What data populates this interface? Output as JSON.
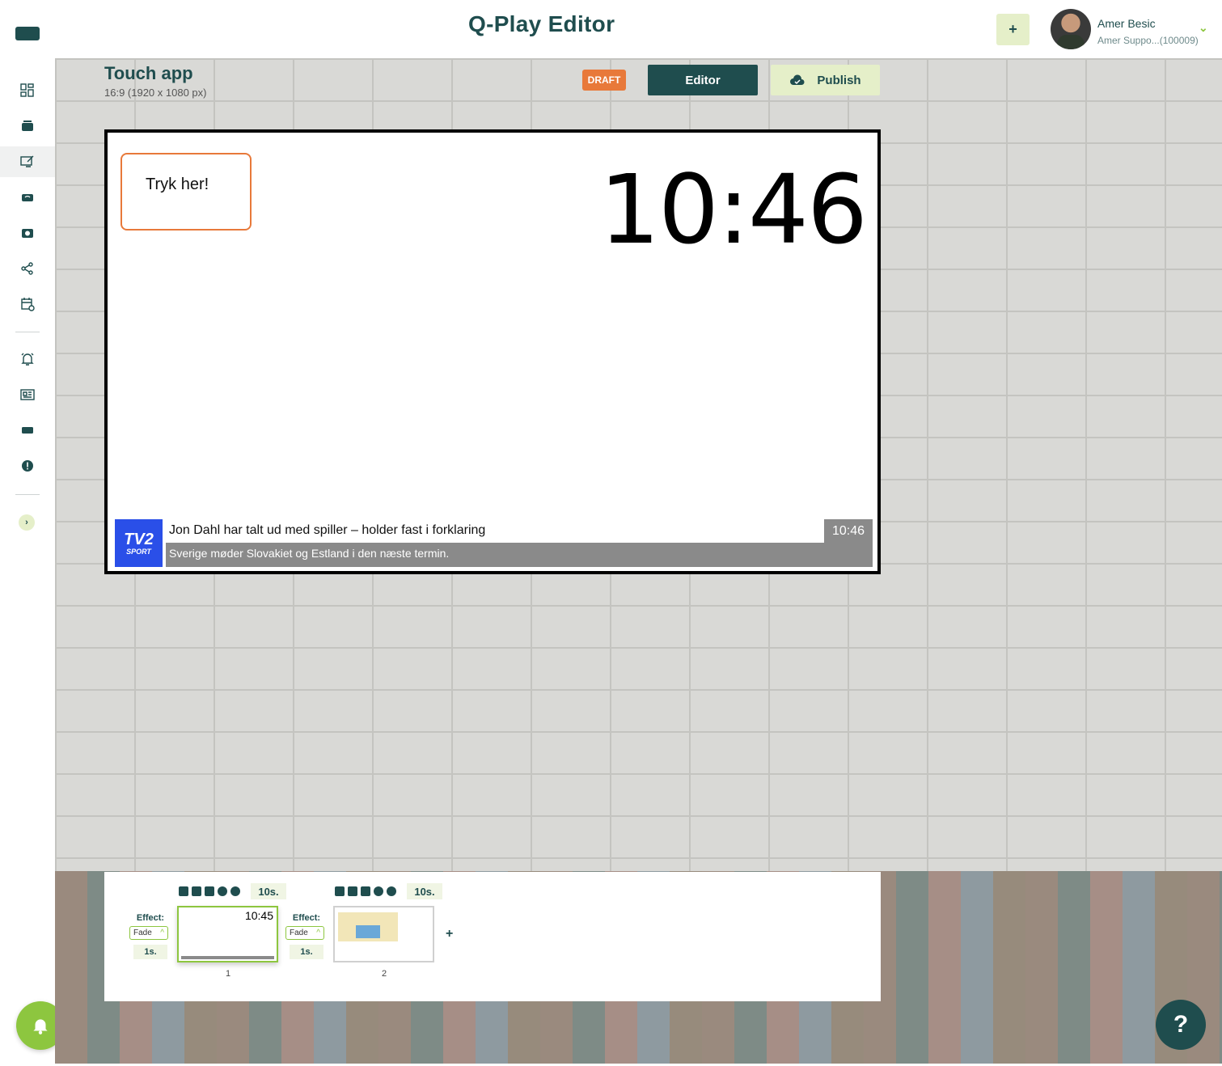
{
  "header": {
    "app_title": "Q-Play Editor",
    "add_label": "+",
    "user_name": "Amer Besic",
    "user_org": "Amer Suppo...(100009)"
  },
  "document": {
    "title": "Touch app",
    "size": "16:9 (1920 x 1080 px)",
    "status": "DRAFT",
    "editor_label": "Editor",
    "publish_label": "Publish"
  },
  "canvas": {
    "touch_button_text": "Tryk her!",
    "clock": "10:46",
    "ticker": {
      "logo_top": "TV2",
      "logo_bottom": "SPORT",
      "headline": "Jon Dahl har talt ud med spiller – holder fast i forklaring",
      "time": "10:46",
      "subline": "Sverige møder Slovakiet og Estland i den næste termin."
    }
  },
  "timeline": {
    "slides": [
      {
        "number": "1",
        "duration": "10s.",
        "effect_label": "Effect:",
        "effect": "Fade",
        "effect_duration": "1s.",
        "thumb_clock": "10:45"
      },
      {
        "number": "2",
        "duration": "10s.",
        "effect_label": "Effect:",
        "effect": "Fade",
        "effect_duration": "1s."
      }
    ],
    "add_label": "+"
  },
  "help_label": "?",
  "colors": {
    "primary": "#1f4d4e",
    "accent": "#8dc63f",
    "draft": "#e8793a",
    "light_green": "#e5efc9"
  }
}
